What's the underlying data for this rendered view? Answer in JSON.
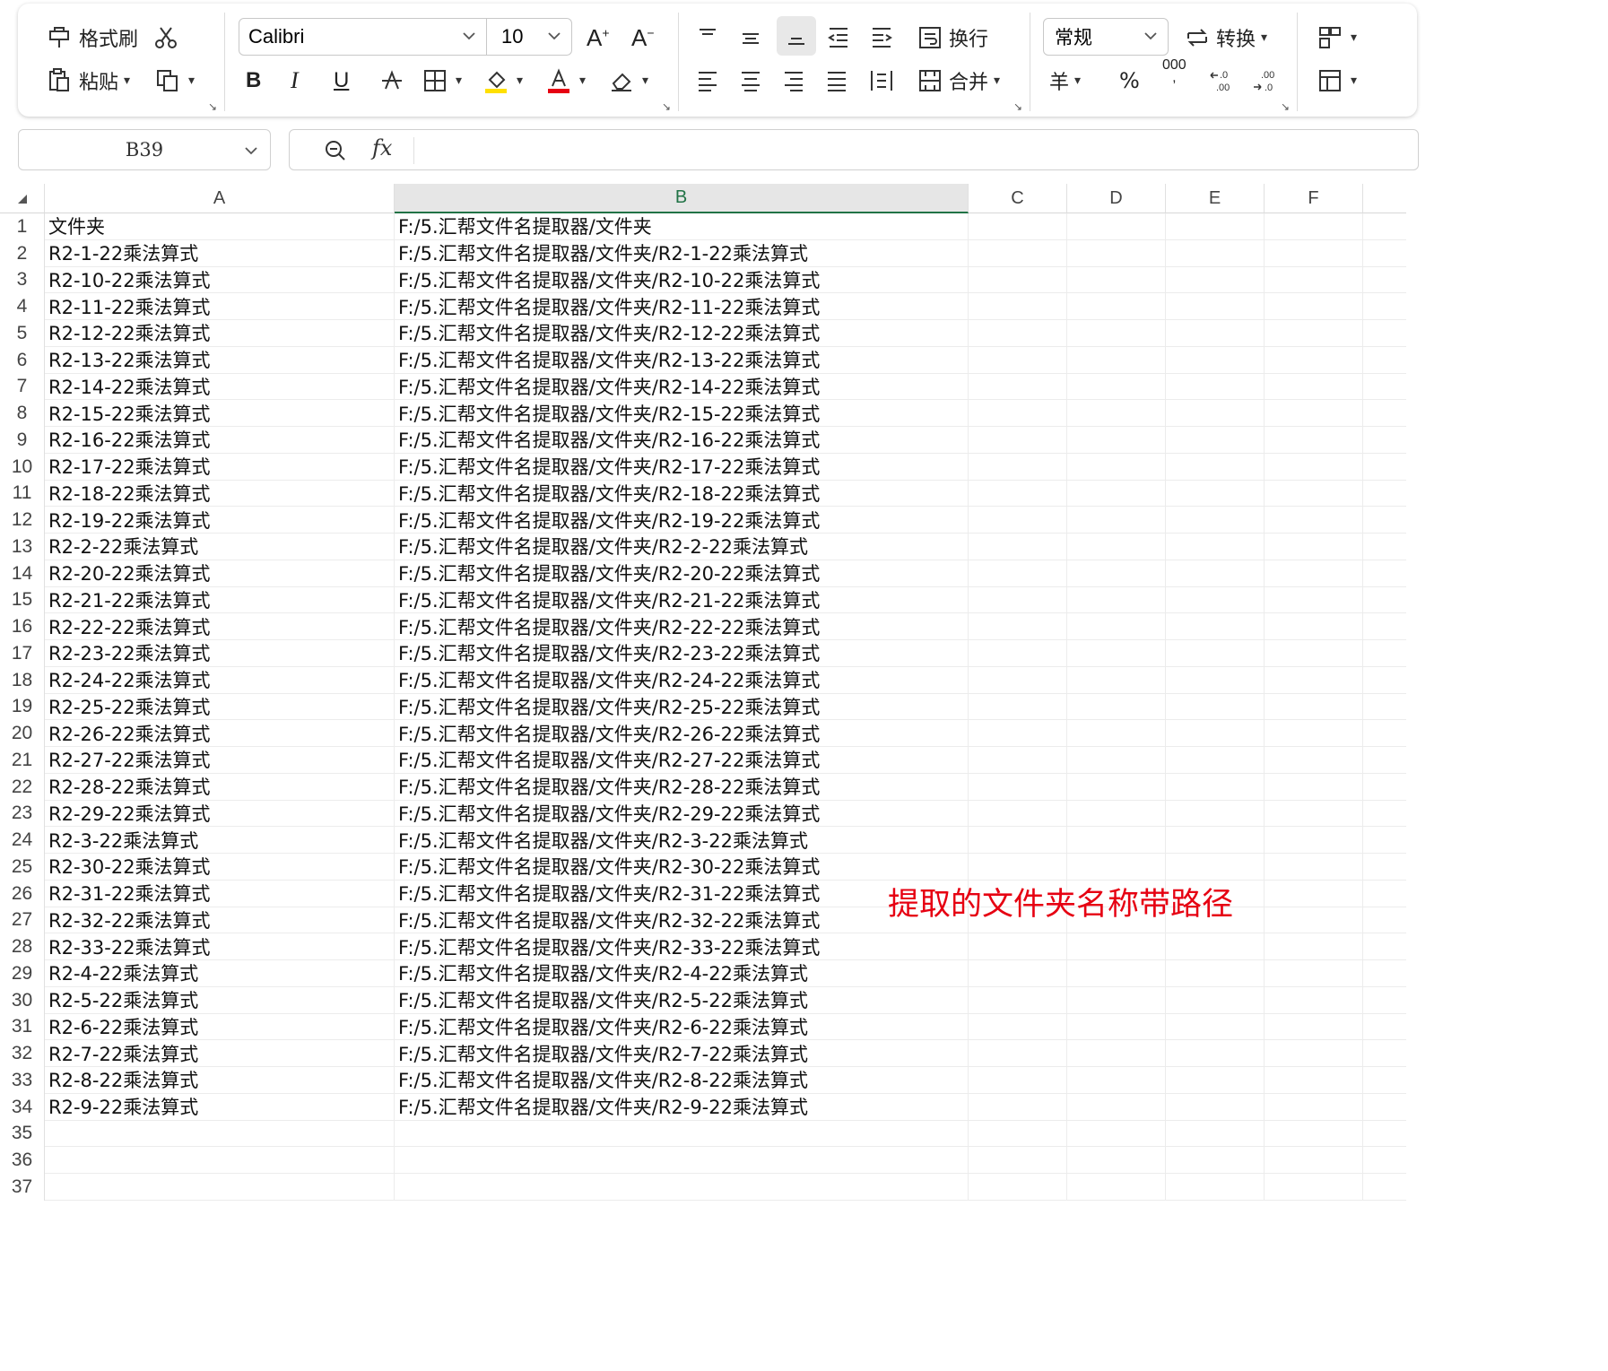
{
  "toolbar": {
    "format_painter": "格式刷",
    "paste": "粘贴",
    "font_name": "Calibri",
    "font_size": "10",
    "wrap": "换行",
    "merge": "合并",
    "number_format": "常规",
    "convert": "转换",
    "bold": "B",
    "italic": "I",
    "underline": "U",
    "percent": "%",
    "thousands": "000",
    "currency": "羊"
  },
  "formula_bar": {
    "cell_ref": "B39",
    "fx": "fx"
  },
  "columns": [
    "A",
    "B",
    "C",
    "D",
    "E",
    "F"
  ],
  "rows": [
    {
      "n": "1",
      "a": "文件夹",
      "b": "F:/5.汇帮文件名提取器/文件夹"
    },
    {
      "n": "2",
      "a": "R2-1-22乘法算式",
      "b": "F:/5.汇帮文件名提取器/文件夹/R2-1-22乘法算式"
    },
    {
      "n": "3",
      "a": "R2-10-22乘法算式",
      "b": "F:/5.汇帮文件名提取器/文件夹/R2-10-22乘法算式"
    },
    {
      "n": "4",
      "a": "R2-11-22乘法算式",
      "b": "F:/5.汇帮文件名提取器/文件夹/R2-11-22乘法算式"
    },
    {
      "n": "5",
      "a": "R2-12-22乘法算式",
      "b": "F:/5.汇帮文件名提取器/文件夹/R2-12-22乘法算式"
    },
    {
      "n": "6",
      "a": "R2-13-22乘法算式",
      "b": "F:/5.汇帮文件名提取器/文件夹/R2-13-22乘法算式"
    },
    {
      "n": "7",
      "a": "R2-14-22乘法算式",
      "b": "F:/5.汇帮文件名提取器/文件夹/R2-14-22乘法算式"
    },
    {
      "n": "8",
      "a": "R2-15-22乘法算式",
      "b": "F:/5.汇帮文件名提取器/文件夹/R2-15-22乘法算式"
    },
    {
      "n": "9",
      "a": "R2-16-22乘法算式",
      "b": "F:/5.汇帮文件名提取器/文件夹/R2-16-22乘法算式"
    },
    {
      "n": "10",
      "a": "R2-17-22乘法算式",
      "b": "F:/5.汇帮文件名提取器/文件夹/R2-17-22乘法算式"
    },
    {
      "n": "11",
      "a": "R2-18-22乘法算式",
      "b": "F:/5.汇帮文件名提取器/文件夹/R2-18-22乘法算式"
    },
    {
      "n": "12",
      "a": "R2-19-22乘法算式",
      "b": "F:/5.汇帮文件名提取器/文件夹/R2-19-22乘法算式"
    },
    {
      "n": "13",
      "a": "R2-2-22乘法算式",
      "b": "F:/5.汇帮文件名提取器/文件夹/R2-2-22乘法算式"
    },
    {
      "n": "14",
      "a": "R2-20-22乘法算式",
      "b": "F:/5.汇帮文件名提取器/文件夹/R2-20-22乘法算式"
    },
    {
      "n": "15",
      "a": "R2-21-22乘法算式",
      "b": "F:/5.汇帮文件名提取器/文件夹/R2-21-22乘法算式"
    },
    {
      "n": "16",
      "a": "R2-22-22乘法算式",
      "b": "F:/5.汇帮文件名提取器/文件夹/R2-22-22乘法算式"
    },
    {
      "n": "17",
      "a": "R2-23-22乘法算式",
      "b": "F:/5.汇帮文件名提取器/文件夹/R2-23-22乘法算式"
    },
    {
      "n": "18",
      "a": "R2-24-22乘法算式",
      "b": "F:/5.汇帮文件名提取器/文件夹/R2-24-22乘法算式"
    },
    {
      "n": "19",
      "a": "R2-25-22乘法算式",
      "b": "F:/5.汇帮文件名提取器/文件夹/R2-25-22乘法算式"
    },
    {
      "n": "20",
      "a": "R2-26-22乘法算式",
      "b": "F:/5.汇帮文件名提取器/文件夹/R2-26-22乘法算式"
    },
    {
      "n": "21",
      "a": "R2-27-22乘法算式",
      "b": "F:/5.汇帮文件名提取器/文件夹/R2-27-22乘法算式"
    },
    {
      "n": "22",
      "a": "R2-28-22乘法算式",
      "b": "F:/5.汇帮文件名提取器/文件夹/R2-28-22乘法算式"
    },
    {
      "n": "23",
      "a": "R2-29-22乘法算式",
      "b": "F:/5.汇帮文件名提取器/文件夹/R2-29-22乘法算式"
    },
    {
      "n": "24",
      "a": "R2-3-22乘法算式",
      "b": "F:/5.汇帮文件名提取器/文件夹/R2-3-22乘法算式"
    },
    {
      "n": "25",
      "a": "R2-30-22乘法算式",
      "b": "F:/5.汇帮文件名提取器/文件夹/R2-30-22乘法算式"
    },
    {
      "n": "26",
      "a": "R2-31-22乘法算式",
      "b": "F:/5.汇帮文件名提取器/文件夹/R2-31-22乘法算式"
    },
    {
      "n": "27",
      "a": "R2-32-22乘法算式",
      "b": "F:/5.汇帮文件名提取器/文件夹/R2-32-22乘法算式"
    },
    {
      "n": "28",
      "a": "R2-33-22乘法算式",
      "b": "F:/5.汇帮文件名提取器/文件夹/R2-33-22乘法算式"
    },
    {
      "n": "29",
      "a": "R2-4-22乘法算式",
      "b": "F:/5.汇帮文件名提取器/文件夹/R2-4-22乘法算式"
    },
    {
      "n": "30",
      "a": "R2-5-22乘法算式",
      "b": "F:/5.汇帮文件名提取器/文件夹/R2-5-22乘法算式"
    },
    {
      "n": "31",
      "a": "R2-6-22乘法算式",
      "b": "F:/5.汇帮文件名提取器/文件夹/R2-6-22乘法算式"
    },
    {
      "n": "32",
      "a": "R2-7-22乘法算式",
      "b": "F:/5.汇帮文件名提取器/文件夹/R2-7-22乘法算式"
    },
    {
      "n": "33",
      "a": "R2-8-22乘法算式",
      "b": "F:/5.汇帮文件名提取器/文件夹/R2-8-22乘法算式"
    },
    {
      "n": "34",
      "a": "R2-9-22乘法算式",
      "b": "F:/5.汇帮文件名提取器/文件夹/R2-9-22乘法算式"
    },
    {
      "n": "35",
      "a": "",
      "b": ""
    },
    {
      "n": "36",
      "a": "",
      "b": ""
    },
    {
      "n": "37",
      "a": "",
      "b": ""
    }
  ],
  "annotation": "提取的文件夹名称带路径",
  "colors": {
    "accent": "#217346",
    "annotation": "#e60012",
    "highlight": "#ffe000",
    "font_color": "#e60012"
  }
}
